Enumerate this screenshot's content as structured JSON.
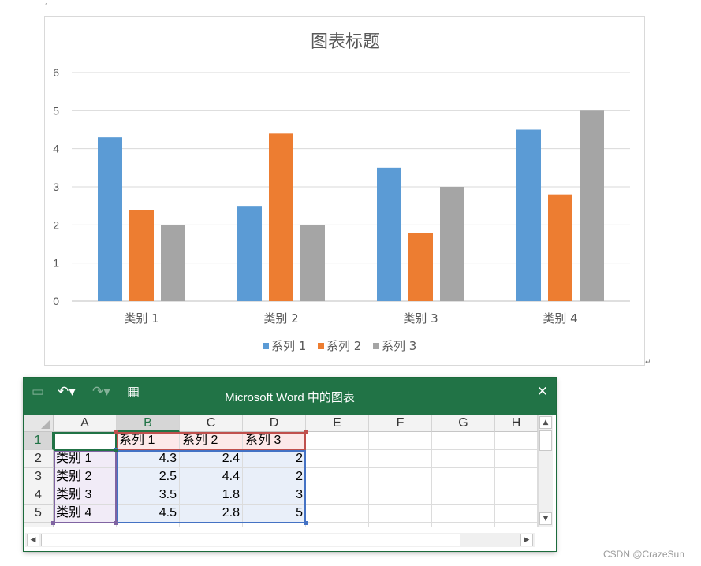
{
  "chart_data": {
    "type": "bar",
    "title": "图表标题",
    "categories": [
      "类别 1",
      "类别 2",
      "类别 3",
      "类别 4"
    ],
    "series": [
      {
        "name": "系列 1",
        "values": [
          4.3,
          2.5,
          3.5,
          4.5
        ],
        "color": "#5b9bd5"
      },
      {
        "name": "系列 2",
        "values": [
          2.4,
          4.4,
          1.8,
          2.8
        ],
        "color": "#ed7d31"
      },
      {
        "name": "系列 3",
        "values": [
          2,
          2,
          3,
          5
        ],
        "color": "#a5a5a5"
      }
    ],
    "ylim": [
      0,
      6
    ],
    "yticks": [
      "0",
      "1",
      "2",
      "3",
      "4",
      "5",
      "6"
    ],
    "grid": true,
    "legend": "bottom"
  },
  "excel": {
    "title": "Microsoft Word 中的图表",
    "icons": {
      "save": "save-icon",
      "undo": "undo-icon",
      "redo": "redo-icon",
      "edit_data": "edit-data-in-excel-icon",
      "close": "close-icon"
    },
    "column_headers": [
      "A",
      "B",
      "C",
      "D",
      "E",
      "F",
      "G",
      "H"
    ],
    "row_headers": [
      "1",
      "2",
      "3",
      "4",
      "5"
    ],
    "rows": [
      [
        "",
        "系列 1",
        "系列 2",
        "系列 3",
        "",
        "",
        "",
        ""
      ],
      [
        "类别 1",
        "4.3",
        "2.4",
        "2",
        "",
        "",
        "",
        ""
      ],
      [
        "类别 2",
        "2.5",
        "4.4",
        "2",
        "",
        "",
        "",
        ""
      ],
      [
        "类别 3",
        "3.5",
        "1.8",
        "3",
        "",
        "",
        "",
        ""
      ],
      [
        "类别 4",
        "4.5",
        "2.8",
        "5",
        "",
        "",
        "",
        ""
      ]
    ],
    "range_colors": {
      "series": "#c0504d",
      "categories": "#8064a2",
      "values": "#4472c4",
      "active": "#217346"
    }
  },
  "watermark": "CSDN @CrazeSun"
}
